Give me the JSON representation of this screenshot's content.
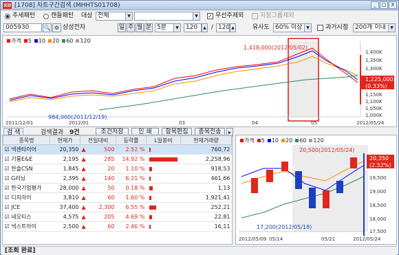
{
  "title_bar": {
    "logo": "XII",
    "title": "[1708] 차트구간검색 (MHHTS01708)",
    "btn_min": "_",
    "btn_max": "□",
    "btn_close": "X"
  },
  "filter_row": {
    "radio_trend": "추세패턴",
    "radio_candle": "캔들패턴",
    "target_label": "대상",
    "target_value": "전체",
    "cb_preferred": "우선주제외",
    "cb_group": "지정그룹제외"
  },
  "query_row": {
    "code": "005930",
    "search_icon_glyph": "🔍",
    "gear_glyph": "⚙",
    "name": "삼성전자",
    "period_buttons": [
      "일",
      "주",
      "월",
      "분"
    ],
    "minute_value": "5분",
    "count_value": "120",
    "count_total": "120",
    "similarity_label": "유사도",
    "similarity_value": "60% 이상",
    "cb_past": "과거시점",
    "past_value": "200개 이내"
  },
  "top_chart": {
    "legend_price": "가격",
    "legend_items": [
      "5",
      "10",
      "20",
      "60",
      "120"
    ],
    "legend_colors": [
      "#ff0000",
      "#0000ff",
      "#ff8c00",
      "#2e8b57",
      "#a0a0a0"
    ],
    "annotation_high": "1,418,000(2012/05/02)",
    "annotation_low": "984,000(2011/12/19)",
    "current_label": "1,225,000",
    "current_pct": "(0.33%)",
    "x_labels": [
      "2011/12/01",
      "2012/01",
      "03",
      "04",
      "05",
      "2012/05/24"
    ],
    "y_labels": [
      "1,400K",
      "1,350K",
      "1,300K",
      "1,250K",
      "1,150K",
      "1,100K",
      "1,050K",
      "1,000K"
    ]
  },
  "result_toolbar": {
    "search_btn": "검 색",
    "result_label": "검색결과",
    "result_count": "9건",
    "cond_save": "조건저장",
    "print": "인 쇄",
    "edit_items": "항목편집",
    "send_items": "종목전송"
  },
  "table": {
    "headers": [
      "종목명",
      "현재가",
      "전일대비",
      "등락률",
      "L일봉비",
      "현재거래량"
    ],
    "rows": [
      {
        "name": "넥센타이어",
        "price": "20,350",
        "change": "500",
        "rate": "2.52 %",
        "bar": 0.05,
        "volume": "760,72"
      },
      {
        "name": "기륭E&E",
        "price": "2,195",
        "change": "285",
        "rate": "14.92 %",
        "bar": 0.9,
        "volume": "2,258,96"
      },
      {
        "name": "한솔CSN",
        "price": "1,845",
        "change": "20",
        "rate": "1.10 %",
        "bar": 0.1,
        "volume": "918,53"
      },
      {
        "name": "G러닝",
        "price": "2,395",
        "change": "140",
        "rate": "6.21 %",
        "bar": 0.05,
        "volume": "461,66"
      },
      {
        "name": "한국기업평가",
        "price": "28,000",
        "change": "50",
        "rate": "0.18 %",
        "bar": 0.12,
        "volume": "1,13"
      },
      {
        "name": "디지아이",
        "price": "3,810",
        "change": "60",
        "rate": "1.60 %",
        "bar": 0.08,
        "volume": "1,921,41"
      },
      {
        "name": "JCE",
        "price": "37,400",
        "change": "2,300",
        "rate": "6.55 %",
        "bar": 0.22,
        "volume": "252,21"
      },
      {
        "name": "네오티스",
        "price": "4,575",
        "change": "205",
        "rate": "4.69 %",
        "bar": 0.1,
        "volume": "22,81"
      },
      {
        "name": "넥스트아이",
        "price": "2,500",
        "change": "60",
        "rate": "2.46 %",
        "bar": 0.05,
        "volume": "16,11"
      }
    ]
  },
  "bottom_chart": {
    "legend_price": "가격",
    "legend_items": [
      "5",
      "10",
      "20",
      "60",
      "120"
    ],
    "annotation_high": "20,500(2012/05/24)",
    "annotation_low": "17,200(2012/05/18)",
    "current_label": "20,350",
    "current_pct": "(2.52%)",
    "y_labels": [
      "19,500",
      "19,000",
      "18,500",
      "18,000",
      "17,500"
    ],
    "x_labels": [
      "2012/05/09",
      "05/14",
      "05/21",
      "2012/05/24"
    ]
  },
  "status": {
    "text": "[조회 완료]"
  }
}
